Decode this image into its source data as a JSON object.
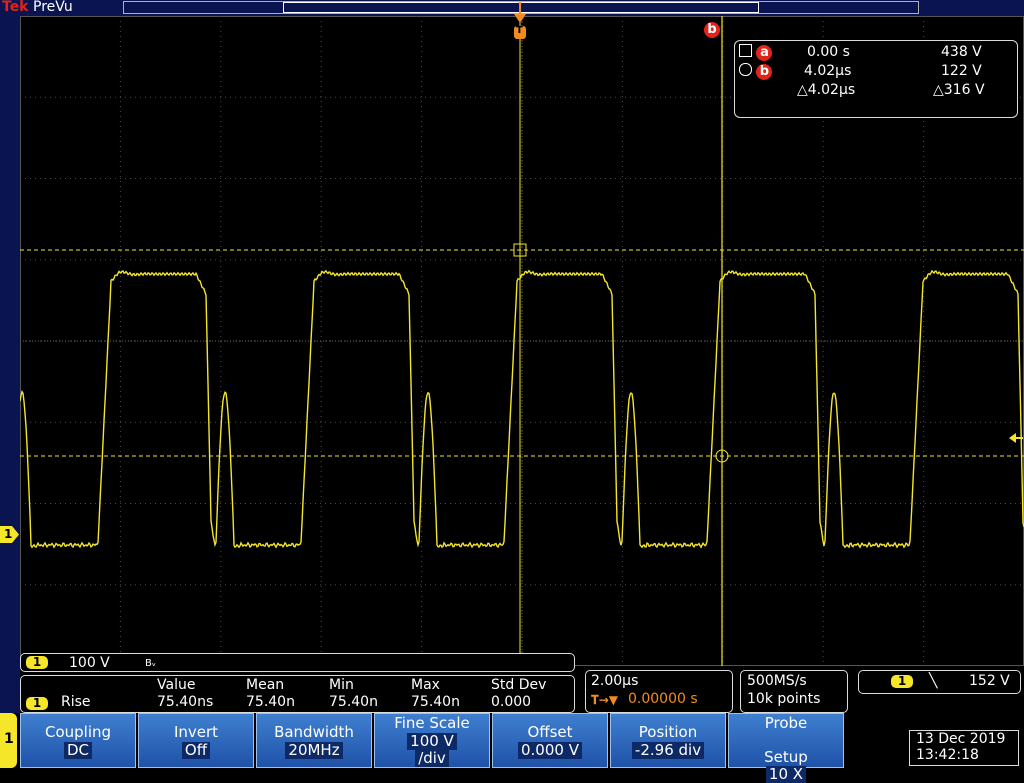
{
  "top_bar": {
    "brand": "Tek",
    "mode": "PreVu"
  },
  "markers": {
    "trigger_marker": "T",
    "cursor_b_marker": "b",
    "ground_marker": "1"
  },
  "cursor_readout": {
    "a_label": "a",
    "a_time": "0.00 s",
    "a_value": "438 V",
    "b_label": "b",
    "b_time": "4.02µs",
    "b_value": "122 V",
    "delta_time": "△4.02µs",
    "delta_value": "△316 V"
  },
  "channel_status": {
    "channel": "1",
    "scale": "100 V",
    "bandwidth_symbol": "Bᵥ"
  },
  "measurement": {
    "channel": "1",
    "name": "Rise",
    "headers": [
      "Value",
      "Mean",
      "Min",
      "Max",
      "Std Dev"
    ],
    "values": [
      "75.40ns",
      "75.40n",
      "75.40n",
      "75.40n",
      "0.000"
    ]
  },
  "timebase": {
    "scale": "2.00µs",
    "delay": "0.00000 s"
  },
  "acquisition": {
    "sample_rate": "500MS/s",
    "record_length": "10k points"
  },
  "trigger": {
    "channel": "1",
    "slope_symbol": "╲",
    "level": "152 V"
  },
  "softkeys": [
    {
      "title": "Coupling",
      "value": "DC"
    },
    {
      "title": "Invert",
      "value": "Off"
    },
    {
      "title": "Bandwidth",
      "value": "20MHz"
    },
    {
      "title": "Fine Scale",
      "value": "100 V",
      "value2": "/div"
    },
    {
      "title": "Offset",
      "value": "0.000 V"
    },
    {
      "title": "Position",
      "value": "-2.96 div"
    },
    {
      "title": "Probe",
      "title2": "Setup",
      "value": "10 X"
    }
  ],
  "menu_channel_tab": "1",
  "datetime": {
    "date": "13 Dec 2019",
    "time": "13:42:18"
  },
  "colors": {
    "channel1": "#f5e62a",
    "cursor_badge": "#e2231a",
    "trigger": "#f28c1e",
    "softkey": "#2f6bc0",
    "topbar": "#0a1450"
  }
}
